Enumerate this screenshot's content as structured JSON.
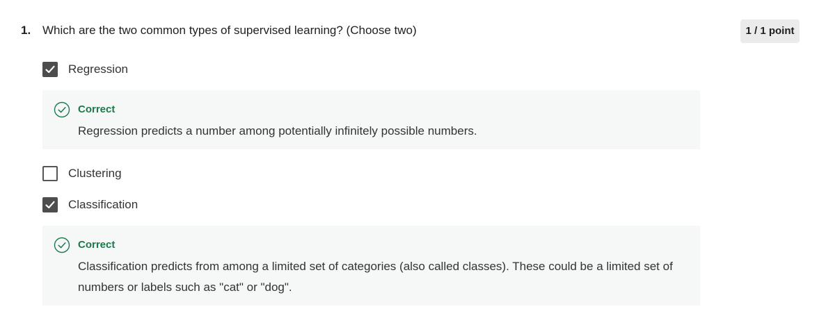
{
  "question": {
    "number": "1.",
    "text": "Which are the two common types of supervised learning? (Choose two)",
    "score": "1 / 1 point"
  },
  "options": [
    {
      "label": "Regression",
      "checked": true,
      "feedback": {
        "status": "Correct",
        "text": "Regression predicts a number among potentially infinitely possible numbers."
      }
    },
    {
      "label": "Clustering",
      "checked": false
    },
    {
      "label": "Classification",
      "checked": true,
      "feedback": {
        "status": "Correct",
        "text": "Classification predicts from among a limited set of categories (also called classes). These could be a limited set of numbers or labels such as \"cat\" or \"dog\"."
      }
    }
  ],
  "colors": {
    "correct_green": "#1b7a4a",
    "checkbox_fill": "#4d4d4d",
    "feedback_bg": "#f5f8f7",
    "badge_bg": "#ebebeb"
  },
  "icons": {
    "check": "check-icon",
    "correct": "check-circle-icon"
  }
}
